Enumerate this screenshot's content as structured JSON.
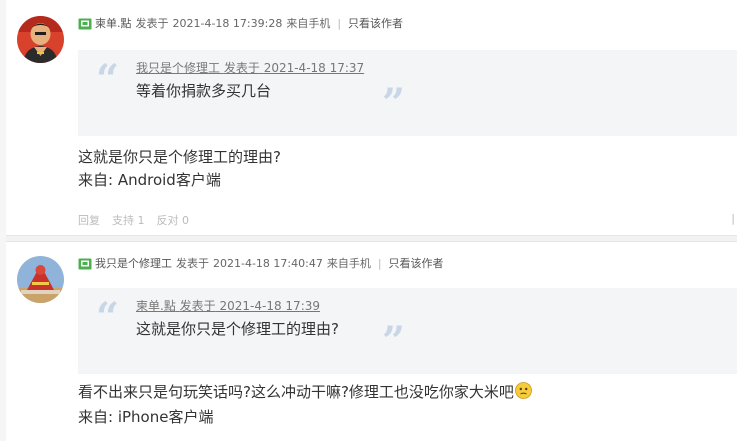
{
  "colors": {
    "quote_bg": "#f4f5f7",
    "quote_marks": "#c9d6e6",
    "flag_green": "#4caf50",
    "muted_text": "#bbbbbb"
  },
  "posts": [
    {
      "author": "柬单.點",
      "posted_prefix": "发表于",
      "posted_time": "2021-4-18 17:39:28",
      "device": "来自手机",
      "only_author": "只看该作者",
      "quote": {
        "author": "我只是个修理工",
        "posted_prefix": "发表于",
        "posted_time": "2021-4-18 17:37",
        "text": "等着你捐款多买几台"
      },
      "body": [
        "这就是你只是个修理工的理由?",
        "来自: Android客户端"
      ],
      "actions": {
        "reply": "回复",
        "support": "支持 1",
        "oppose": "反对 0"
      },
      "right_mark": "|"
    },
    {
      "author": "我只是个修理工",
      "posted_prefix": "发表于",
      "posted_time": "2021-4-18 17:40:47",
      "device": "来自手机",
      "only_author": "只看该作者",
      "quote": {
        "author": "柬单.點",
        "posted_prefix": "发表于",
        "posted_time": "2021-4-18 17:39",
        "text": "这就是你只是个修理工的理由?"
      },
      "body": [
        "看不出来只是句玩笑话吗?这么冲动干嘛?修理工也没吃你家大米吧",
        "来自: iPhone客户端"
      ],
      "emoji": "confused-face-icon"
    }
  ]
}
